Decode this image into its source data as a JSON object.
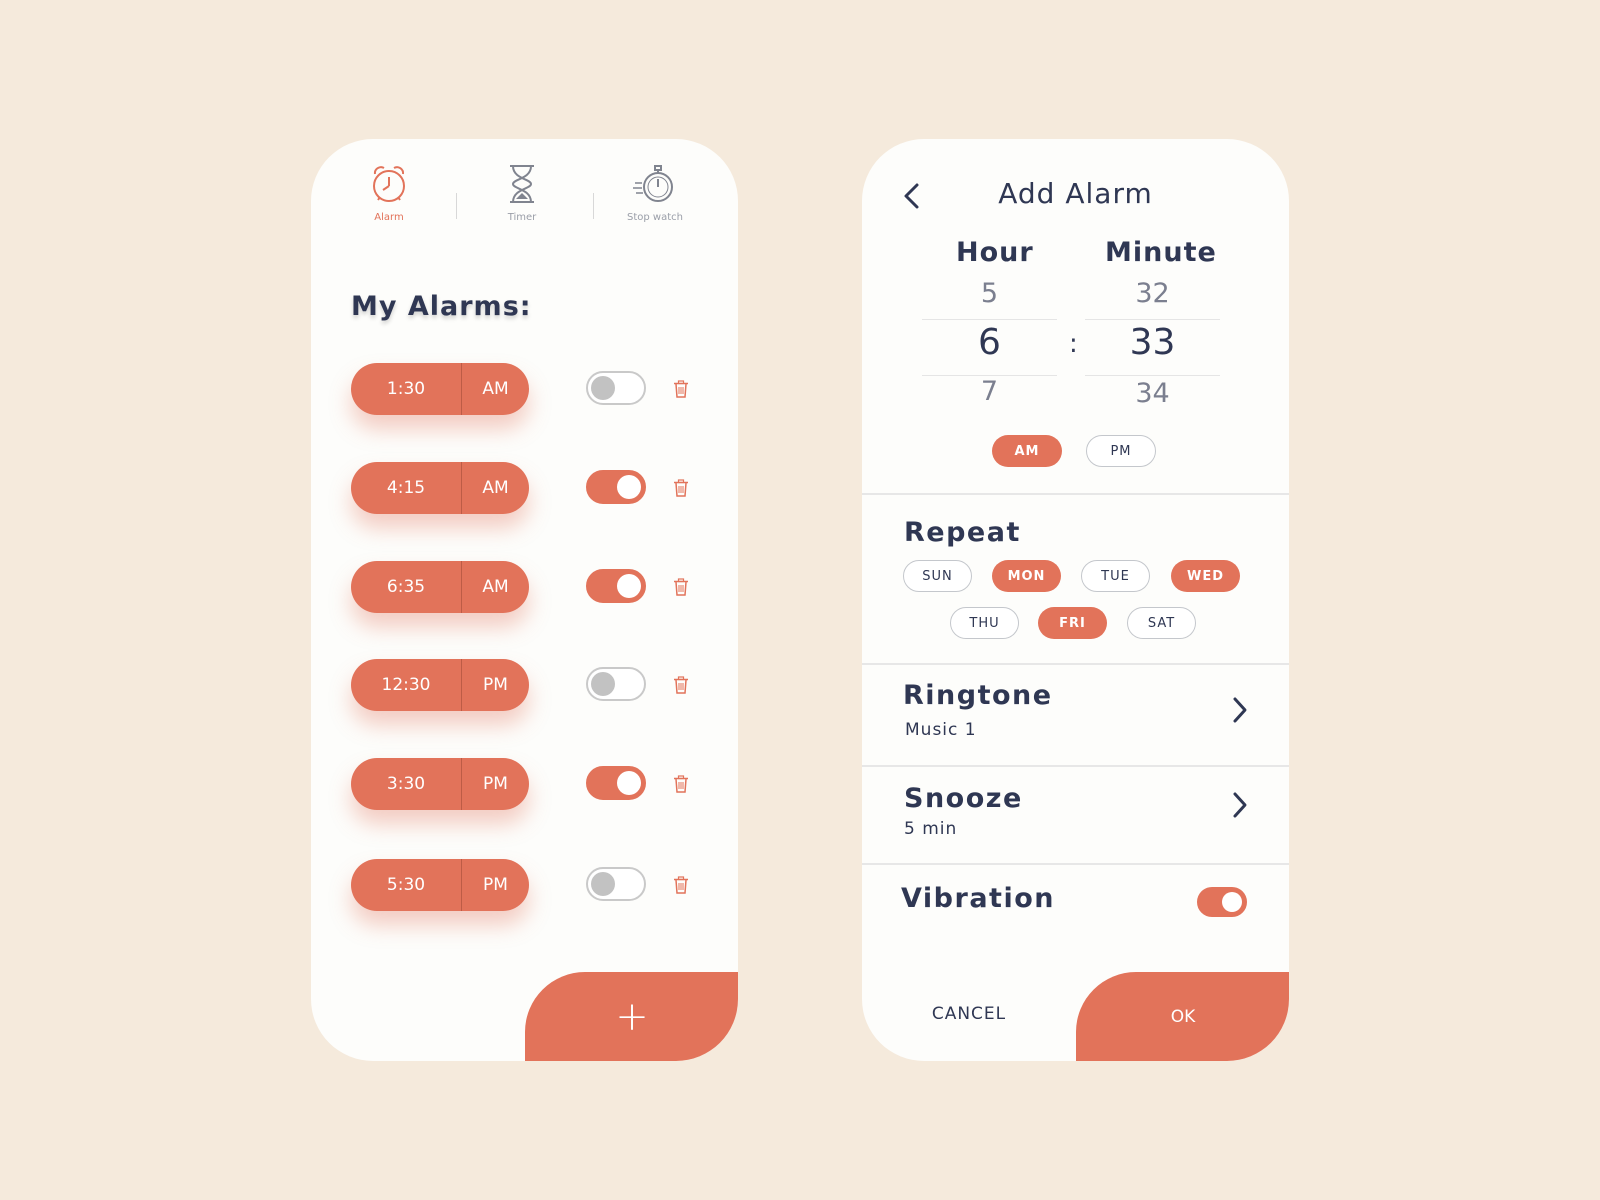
{
  "tabs": [
    {
      "label": "Alarm",
      "icon": "alarm-clock-icon",
      "active": true
    },
    {
      "label": "Timer",
      "icon": "hourglass-icon",
      "active": false
    },
    {
      "label": "Stop watch",
      "icon": "stopwatch-icon",
      "active": false
    }
  ],
  "alarms_title": "My Alarms:",
  "alarms": [
    {
      "time": "1:30",
      "period": "AM",
      "enabled": false
    },
    {
      "time": "4:15",
      "period": "AM",
      "enabled": true
    },
    {
      "time": "6:35",
      "period": "AM",
      "enabled": true
    },
    {
      "time": "12:30",
      "period": "PM",
      "enabled": false
    },
    {
      "time": "3:30",
      "period": "PM",
      "enabled": true
    },
    {
      "time": "5:30",
      "period": "PM",
      "enabled": false
    }
  ],
  "add_button": "+",
  "add_alarm": {
    "title": "Add Alarm",
    "hour_label": "Hour",
    "minute_label": "Minute",
    "hours": [
      "5",
      "6",
      "7"
    ],
    "minutes": [
      "32",
      "33",
      "34"
    ],
    "separator": ":",
    "am_label": "AM",
    "pm_label": "PM",
    "period_selected": "AM",
    "repeat_label": "Repeat",
    "days": [
      {
        "label": "SUN",
        "selected": false
      },
      {
        "label": "MON",
        "selected": true
      },
      {
        "label": "TUE",
        "selected": false
      },
      {
        "label": "WED",
        "selected": true
      },
      {
        "label": "THU",
        "selected": false
      },
      {
        "label": "FRI",
        "selected": true
      },
      {
        "label": "SAT",
        "selected": false
      }
    ],
    "ringtone_label": "Ringtone",
    "ringtone_value": "Music 1",
    "snooze_label": "Snooze",
    "snooze_value": "5 min",
    "vibration_label": "Vibration",
    "vibration_on": true,
    "cancel_label": "CANCEL",
    "ok_label": "OK"
  },
  "colors": {
    "accent": "#e2735a",
    "text": "#2f3753",
    "background": "#f5eadc"
  }
}
